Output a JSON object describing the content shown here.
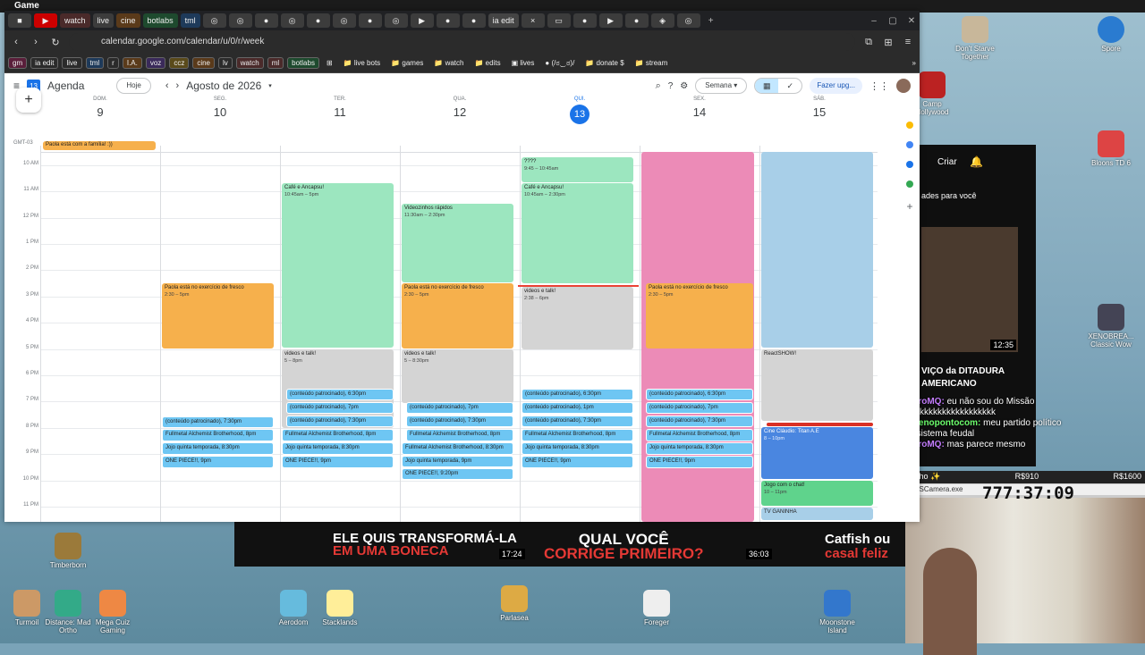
{
  "os": {
    "title": "Game"
  },
  "browser": {
    "tabs": [
      "watch",
      "live",
      "cine",
      "botlabs",
      "tml",
      "ia edit"
    ],
    "url": "calendar.google.com/calendar/u/0/r/week",
    "bookmarks": [
      "gm",
      "ia edit",
      "live",
      "tml",
      "r",
      "I.A.",
      "voz",
      "ccz",
      "cine",
      "lv",
      "watch",
      "ml",
      "botlabs"
    ],
    "folders": [
      "live bots",
      "games",
      "watch",
      "edits",
      "lives",
      "(/ಠ‿ಠ)/",
      "donate $",
      "stream"
    ]
  },
  "cal": {
    "app": "Agenda",
    "today_btn": "Hoje",
    "month": "Agosto de 2026",
    "view": "Semana",
    "upgrade": "Fazer upg...",
    "tz": "GMT-03",
    "days": [
      {
        "n": "DOM.",
        "d": "9"
      },
      {
        "n": "SEG.",
        "d": "10"
      },
      {
        "n": "TER.",
        "d": "11"
      },
      {
        "n": "QUA.",
        "d": "12"
      },
      {
        "n": "QUI.",
        "d": "13"
      },
      {
        "n": "SEX.",
        "d": "14"
      },
      {
        "n": "SÁB.",
        "d": "15"
      }
    ],
    "hours": [
      "10 AM",
      "11 AM",
      "12 PM",
      "1 PM",
      "2 PM",
      "3 PM",
      "4 PM",
      "5 PM",
      "6 PM",
      "7 PM",
      "8 PM",
      "9 PM",
      "10 PM",
      "11 PM"
    ],
    "allday": "Paola está com a família! :))",
    "ev": {
      "cafe": "Café e Ancapsu!",
      "cafe_t": "10:45am – 5pm",
      "cafe2_t": "10:45am – 2:30pm",
      "q": "????",
      "q_t": "9:45 – 10:45am",
      "vid": "Videozinhos rápidos",
      "vid_t": "11:30am – 2:30pm",
      "paola": "Paola está no exercício de fresco",
      "paola_t": "2:30 – 5pm",
      "vt": "videos e talk!",
      "vt_t1": "5 – 8pm",
      "vt_t2": "5 – 8:30pm",
      "vt_t3": "2:38 – 6pm",
      "s1": "(conteúdo patrocinado), 6:30pm",
      "s2": "(conteúdo patrocinado), 7pm",
      "s3": "(conteúdo patrocinado), 7:30pm",
      "fma": "Fullmetal Alchemist Brotherhood, 8pm",
      "fma2": "Fullmetal Alchemist Brotherhood, 8:30pm",
      "jojo": "Jojo quinta temporada, 8:30pm",
      "jojo2": "Jojo quinta temporada, 9pm",
      "op": "ONE PIECE!!, 9pm",
      "op2": "ONE PIECE!!, 9:20pm",
      "s1p": "(conteúdo patrocinado), 1pm",
      "react": "ReactSHOW!",
      "cine": "Cine Cláudio: Titan A.E",
      "cine_t": "8 – 10pm",
      "jogo": "Jogo com o chat!",
      "jogo_t": "10 – 11pm",
      "tv": "TV GANINHA"
    }
  },
  "yt": {
    "criar": "Criar",
    "rec": "ades para você",
    "dur": "12:35",
    "title1": "VIÇO da DITADURA",
    "title2": "AMERICANO"
  },
  "chat": [
    {
      "u": "PietroMQ:",
      "m": "eu não sou do Missão",
      "c": "#c47dff"
    },
    {
      "u": "",
      "m": "kkkkkkkkkkkkkkkkkkkkk",
      "c": "#fff"
    },
    {
      "u": "morenopontocom:",
      "m": "meu partido político",
      "c": "#6cff6c"
    },
    {
      "u": "",
      "m": "é o sistema feudal",
      "c": "#fff"
    },
    {
      "u": "PietroMQ:",
      "m": "mas parece mesmo",
      "c": "#c47dff"
    }
  ],
  "stream": {
    "julho": "Julho ✨",
    "r1": "R$910",
    "r2": "R$1600",
    "cam": "OBSCamera.exe",
    "timer": "777:37:09"
  },
  "desktop": {
    "icons": [
      "Don't Starve Together",
      "Spore",
      "Camp Hollywood",
      "Bloons TD 6",
      "XENOBREA... Classic Wow",
      "Timberborn",
      "Turmoil",
      "Distance: Mad Ortho",
      "Mega Cuiz Gaming",
      "Aerodom",
      "Stacklands",
      "Parlasea",
      "Foreger",
      "Moonstone Island"
    ]
  },
  "banner": {
    "a1": "ELE QUIS TRANSFORMÁ-LA",
    "a2": "EM UMA BONECA",
    "b1": "QUAL VOCÊ",
    "b2": "CORRIGE PRIMEIRO?",
    "c1": "Catfish ou",
    "c2": "casal feliz",
    "t1": "17:24",
    "t2": "36:03"
  }
}
